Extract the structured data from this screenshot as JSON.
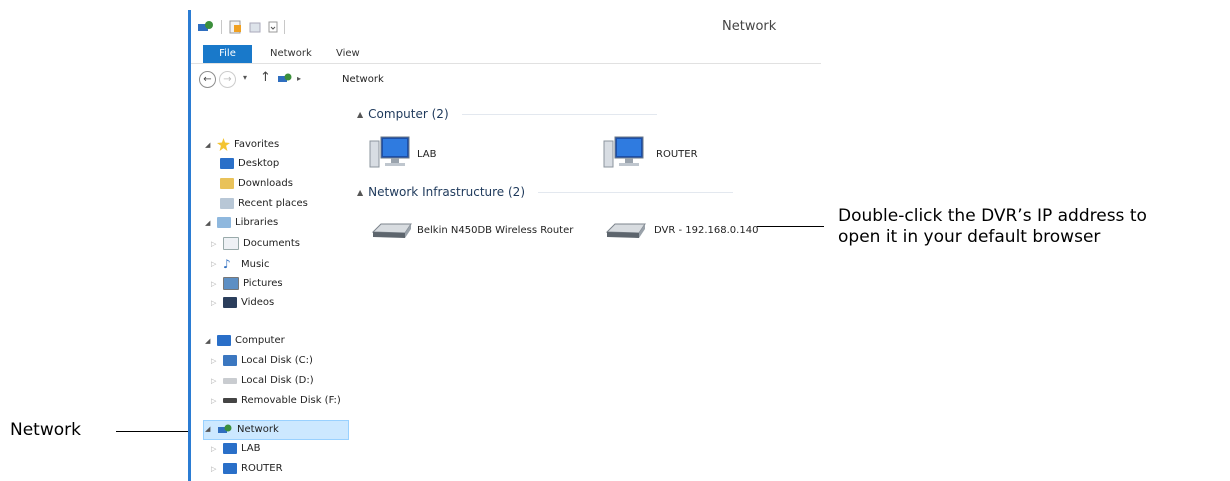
{
  "window": {
    "title": "Network"
  },
  "ribbon": {
    "tabs": [
      "File",
      "Network",
      "View"
    ]
  },
  "address": {
    "path": "Network",
    "separator": "▸"
  },
  "tree": {
    "favorites": {
      "label": "Favorites",
      "items": [
        "Desktop",
        "Downloads",
        "Recent places"
      ]
    },
    "libraries": {
      "label": "Libraries",
      "items": [
        "Documents",
        "Music",
        "Pictures",
        "Videos"
      ]
    },
    "computer": {
      "label": "Computer",
      "items": [
        "Local Disk (C:)",
        "Local Disk (D:)",
        "Removable Disk (F:)"
      ]
    },
    "network": {
      "label": "Network",
      "items": [
        "LAB",
        "ROUTER"
      ]
    }
  },
  "content": {
    "groups": [
      {
        "label": "Computer (2)",
        "items": [
          "LAB",
          "ROUTER"
        ]
      },
      {
        "label": "Network Infrastructure (2)",
        "items": [
          "Belkin N450DB Wireless Router",
          "DVR - 192.168.0.140"
        ]
      }
    ]
  },
  "callouts": {
    "network": "Network",
    "dvr_line1": "Double-click the DVR’s IP address to",
    "dvr_line2": "open it in your default browser"
  },
  "colors": {
    "accent": "#1979ca",
    "selection": "#cce8ff",
    "group_text": "#1e395b"
  }
}
